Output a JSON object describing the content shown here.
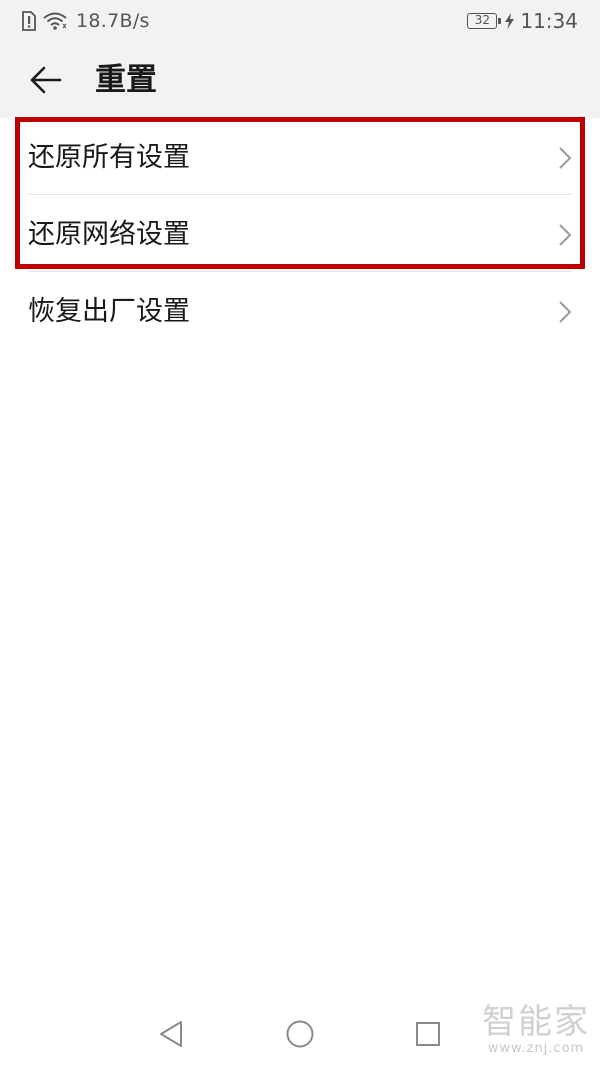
{
  "status_bar": {
    "speed": "18.7B/s",
    "battery": "32",
    "time": "11:34"
  },
  "header": {
    "title": "重置"
  },
  "list": {
    "items": [
      {
        "label": "还原所有设置"
      },
      {
        "label": "还原网络设置"
      },
      {
        "label": "恢复出厂设置"
      }
    ]
  },
  "watermark": {
    "name": "智能家",
    "url": "www.znj.com"
  },
  "colors": {
    "highlight": "#c00000",
    "header_bg": "#f2f2f2"
  }
}
